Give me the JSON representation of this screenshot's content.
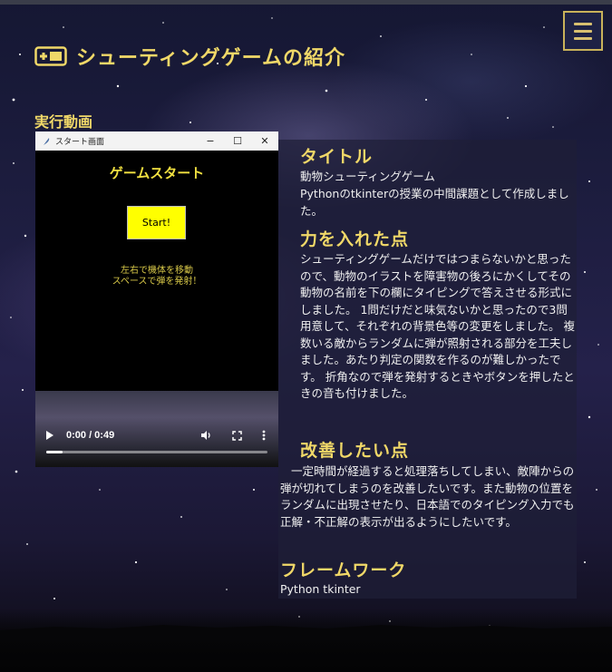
{
  "page": {
    "title": "シューティングゲームの紹介",
    "menu_icon": "hamburger-menu-icon",
    "title_icon": "gamepad-icon"
  },
  "video_section": {
    "label": "実行動画",
    "window_title": "スタート画面",
    "window_controls": {
      "minimize": "−",
      "maximize": "☐",
      "close": "✕"
    },
    "game_title": "ゲームスタート",
    "start_button": "Start!",
    "instructions": [
      "左右で機体を移動",
      "スペースで弾を発射！"
    ],
    "player": {
      "time": "0:00 / 0:49",
      "progress": 0.0
    }
  },
  "description": {
    "sections": [
      {
        "heading": "タイトル",
        "paragraphs": [
          "動物シューティングゲーム",
          "Pythonのtkinterの授業の中間課題として作成しました。"
        ]
      },
      {
        "heading": "力を入れた点",
        "paragraphs": [
          "シューティングゲームだけではつまらないかと思ったので、動物のイラストを障害物の後ろにかくしてその動物の名前を下の欄にタイピングで答えさせる形式にしました。 1問だけだと味気ないかと思ったので3問用意して、それぞれの背景色等の変更をしました。 複数いる敵からランダムに弾が照射される部分を工夫しました。あたり判定の関数を作るのが難しかったです。 折角なので弾を発射するときやボタンを押したときの音も付けました。"
        ]
      },
      {
        "heading": "改善したい点",
        "paragraphs": [
          "一定時間が経過すると処理落ちしてしまい、敵陣からの弾が切れてしまうのを改善したいです。また動物の位置をランダムに出現させたり、日本語でのタイピング入力でも正解・不正解の表示が出るようにしたいです。"
        ]
      },
      {
        "heading": "フレームワーク",
        "paragraphs": [
          "Python tkinter"
        ]
      }
    ]
  },
  "colors": {
    "accent": "#f0d868",
    "game_yellow": "#ffff00",
    "panel_bg": "#1e1e37"
  }
}
